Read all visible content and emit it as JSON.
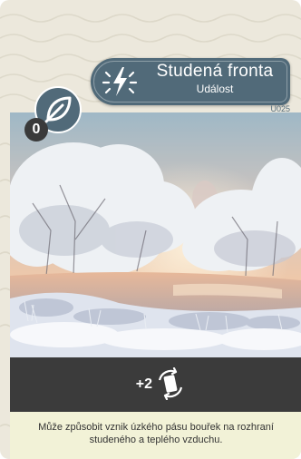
{
  "card": {
    "title": "Studená fronta",
    "type": "Událost",
    "code": "U025",
    "cost": "0",
    "effect_value": "+2",
    "description": "Může způsobit vznik úzkého pásu bouřek na rozhraní studeného a teplého vzduchu."
  },
  "icons": {
    "title": "lightning-cold-icon",
    "category": "leaf-icon",
    "effect": "rotating-card-icon"
  },
  "colors": {
    "plate": "#516a79",
    "bar": "#3b3b3b",
    "description_background": "#f2f2d7",
    "cost_badge": "#3a3a3a"
  }
}
